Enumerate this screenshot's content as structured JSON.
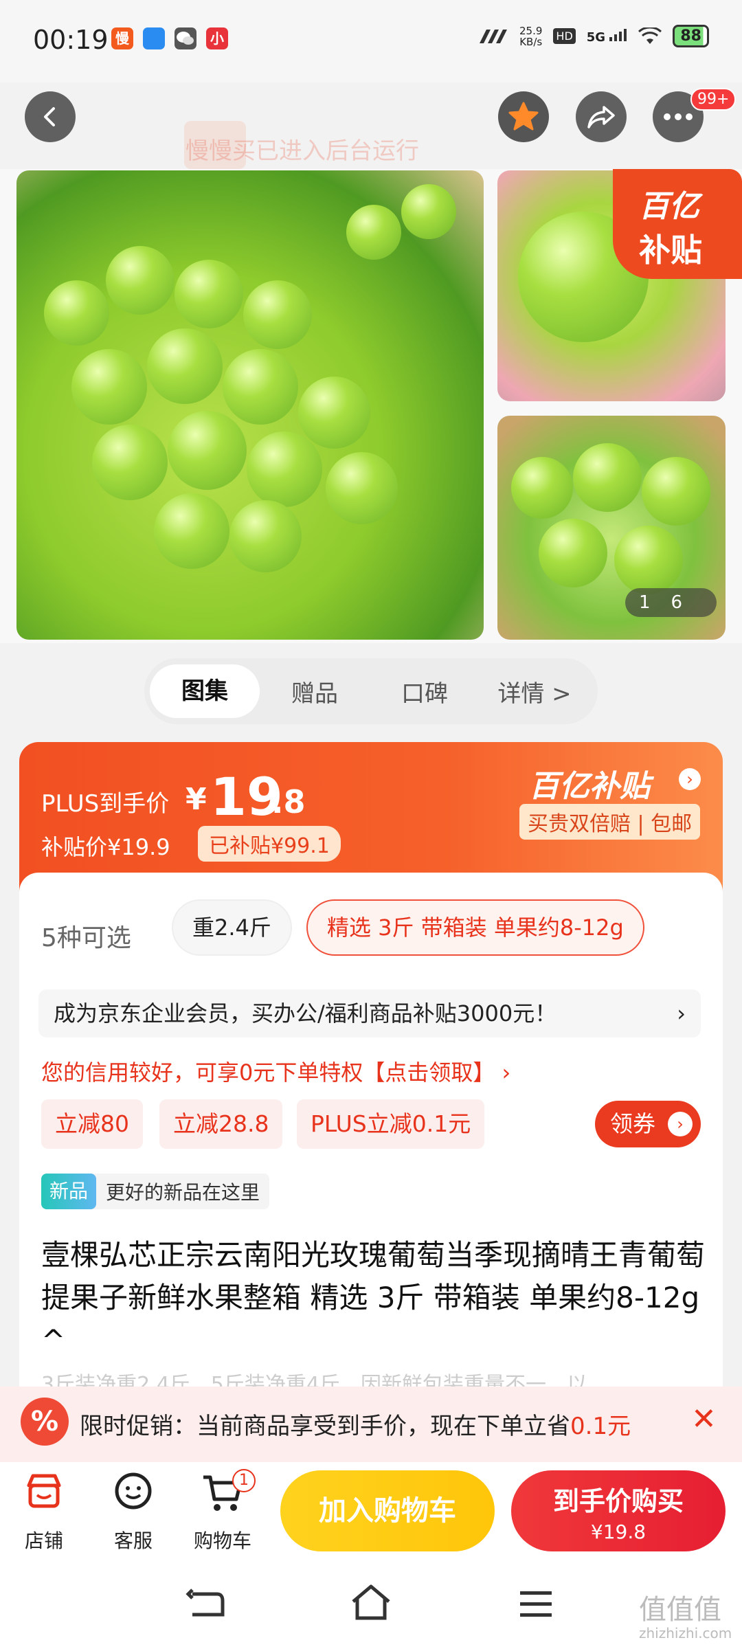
{
  "status_bar": {
    "time": "00:19",
    "apps": [
      {
        "icon": "manman-app-icon",
        "text": "慢",
        "color": "#f35a1e"
      },
      {
        "icon": "message-app-icon",
        "text": "",
        "color": "#2a8cf0"
      },
      {
        "icon": "wechat-icon",
        "text": "",
        "color": "#555555"
      },
      {
        "icon": "xiaohongshu-icon",
        "text": "小",
        "color": "#e8333a"
      }
    ],
    "net_speed": "25.9",
    "net_unit": "KB/s",
    "hd": "HD",
    "signal": "5G",
    "battery": "88"
  },
  "top_nav": {
    "more_badge": "99+",
    "toast": "慢慢买已进入后台运行"
  },
  "gallery": {
    "subsidy_line1": "百亿",
    "subsidy_line2": "补贴",
    "counter_current": "1",
    "counter_total": "6"
  },
  "tabs": [
    {
      "label": "图集",
      "active": true
    },
    {
      "label": "赠品",
      "active": false
    },
    {
      "label": "口碑",
      "active": false
    },
    {
      "label": "详情 >",
      "active": false
    }
  ],
  "price": {
    "plus_label": "PLUS到手价",
    "yen": "¥",
    "integer": "19",
    "decimal": ".8",
    "subsidy_price": "补贴价¥19.9",
    "subsidy_badge": "已补贴¥99.1",
    "brand_title": "百亿补贴",
    "brand_sub": "买贵双倍赔 | 包邮"
  },
  "variants": {
    "count_label": "5种可选",
    "options": [
      "重2.4斤",
      "精选 3斤 带箱装 单果约8-12g"
    ],
    "selected_index": 1
  },
  "promo_row": {
    "text": "成为京东企业会员，买办公/福利商品补贴3000元！",
    "chevron": "›"
  },
  "credit": "您的信用较好，可享0元下单特权【点击领取】 ›",
  "coupons": [
    "立减80",
    "立减28.8",
    "PLUS立减0.1元"
  ],
  "get_coupon": "领券",
  "new_tag": {
    "tag": "新品",
    "desc": "更好的新品在这里"
  },
  "product_title": "壹棵弘芯正宗云南阳光玫瑰葡萄当季现摘晴王青葡萄提果子新鲜水果整箱 精选 3斤 带箱装 单果约8-12g ^",
  "faded_text": "3斤装净重2.4斤，5斤装净重4斤，因新鲜包装重量不一，以",
  "limit_bar": {
    "icon": "%",
    "text_prefix": "限时促销：当前商品享受到手价，现在下单立省",
    "text_highlight": "0.1元",
    "close": "✕"
  },
  "bottom_bar": {
    "store": "店铺",
    "service": "客服",
    "cart": "购物车",
    "cart_count": "1",
    "add_to_cart": "加入购物车",
    "buy_label": "到手价购买",
    "buy_price": "¥19.8"
  },
  "watermark": {
    "main": "值值值",
    "sub": "zhizhizhi.com"
  }
}
